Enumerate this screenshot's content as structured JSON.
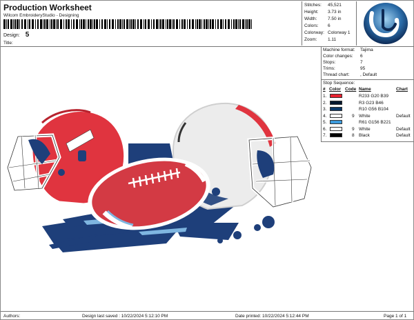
{
  "header": {
    "title": "Production Worksheet",
    "subtitle": "Wilcom EmbroideryStudio - Designing",
    "design_label": "Design:",
    "design_number": "5",
    "title_label": "Title:"
  },
  "stats": [
    {
      "key": "Stitches:",
      "value": "45,521"
    },
    {
      "key": "Height:",
      "value": "3.73 in"
    },
    {
      "key": "Width:",
      "value": "7.50 in"
    },
    {
      "key": "Colors:",
      "value": "6"
    },
    {
      "key": "Colorway:",
      "value": "Colorway 1"
    },
    {
      "key": "Zoom:",
      "value": "1.11"
    }
  ],
  "machine_info": [
    {
      "key": "Machine format:",
      "value": "Tajima"
    },
    {
      "key": "Color changes:",
      "value": "6"
    },
    {
      "key": "Stops:",
      "value": "7"
    },
    {
      "key": "Trims:",
      "value": "95"
    },
    {
      "key": "Thread chart:",
      "value": ", Default"
    }
  ],
  "stop_sequence": {
    "title": "Stop Sequence:",
    "headers": {
      "num": "#",
      "color": "Color",
      "code": "Code",
      "name": "Name",
      "chart": "Chart"
    },
    "rows": [
      {
        "num": "1.",
        "swatch": "#e8212f",
        "code": "",
        "name": "R233 G20 B39",
        "chart": ""
      },
      {
        "num": "2.",
        "swatch": "#03172e",
        "code": "",
        "name": "R3 G23 B46",
        "chart": ""
      },
      {
        "num": "3.",
        "swatch": "#0a3868",
        "code": "",
        "name": "R10 G56 B104",
        "chart": ""
      },
      {
        "num": "4.",
        "swatch": "#ffffff",
        "code": "9",
        "name": "White",
        "chart": "Default"
      },
      {
        "num": "5.",
        "swatch": "#3d9cdd",
        "code": "",
        "name": "R61 G156 B221",
        "chart": ""
      },
      {
        "num": "6.",
        "swatch": "#ffffff",
        "code": "9",
        "name": "White",
        "chart": "Default"
      },
      {
        "num": "7.",
        "swatch": "#000000",
        "code": "8",
        "name": "Black",
        "chart": "Default"
      }
    ]
  },
  "footer": {
    "authors": "Authors:",
    "saved": "Design last saved : 10/22/2024 5:12:10 PM",
    "printed": "Date printed: 10/22/2024 5:12:44 PM",
    "page": "Page 1 of 1"
  },
  "colors": {
    "helmet_red": "#e0343f",
    "helmet_white": "#ececec",
    "navy": "#1e3f7a",
    "light_blue": "#7fb6e0",
    "ball": "#d33a44"
  },
  "logo_icon": "wilcom-logo-icon"
}
